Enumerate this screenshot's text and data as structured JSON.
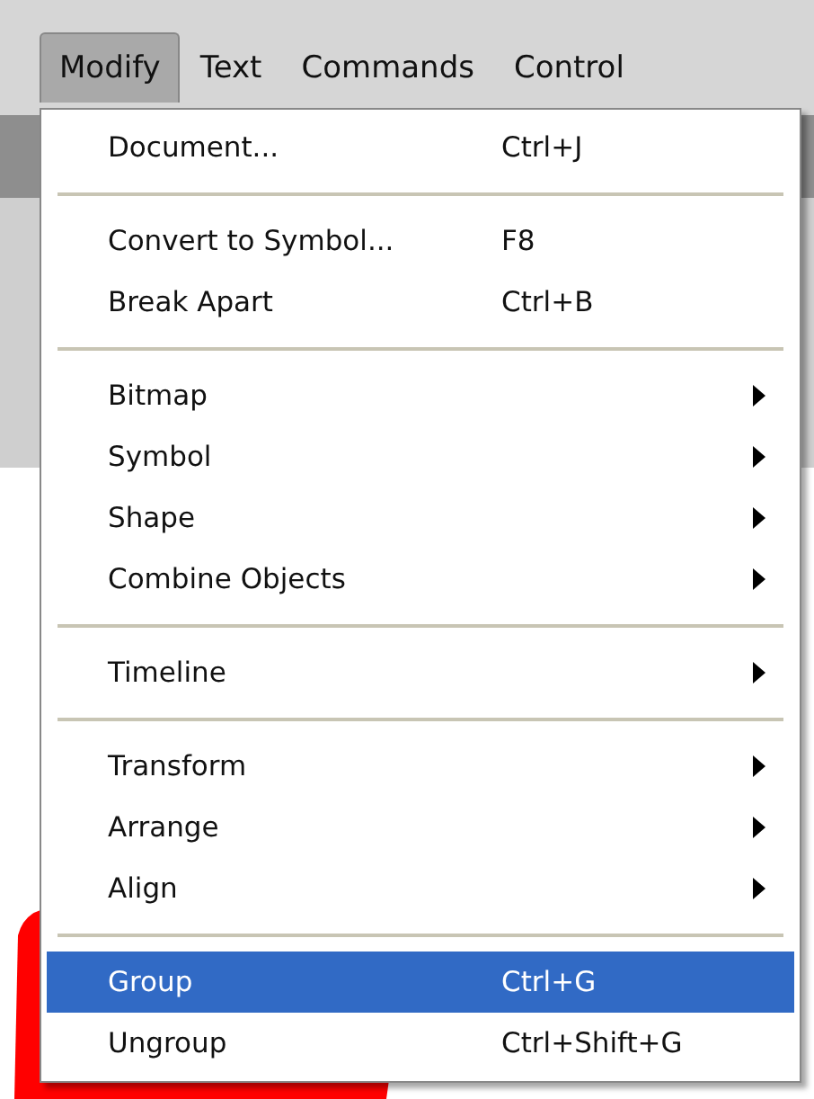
{
  "menubar": [
    {
      "label": "Modify",
      "selected": true
    },
    {
      "label": "Text",
      "selected": false
    },
    {
      "label": "Commands",
      "selected": false
    },
    {
      "label": "Control",
      "selected": false
    }
  ],
  "menu": {
    "sections": [
      [
        {
          "label": "Document...",
          "shortcut": "Ctrl+J",
          "submenu": false,
          "selected": false
        }
      ],
      [
        {
          "label": "Convert to Symbol...",
          "shortcut": "F8",
          "submenu": false,
          "selected": false
        },
        {
          "label": "Break Apart",
          "shortcut": "Ctrl+B",
          "submenu": false,
          "selected": false
        }
      ],
      [
        {
          "label": "Bitmap",
          "submenu": true,
          "selected": false
        },
        {
          "label": "Symbol",
          "submenu": true,
          "selected": false
        },
        {
          "label": "Shape",
          "submenu": true,
          "selected": false
        },
        {
          "label": "Combine Objects",
          "submenu": true,
          "selected": false
        }
      ],
      [
        {
          "label": "Timeline",
          "submenu": true,
          "selected": false
        }
      ],
      [
        {
          "label": "Transform",
          "submenu": true,
          "selected": false
        },
        {
          "label": "Arrange",
          "submenu": true,
          "selected": false
        },
        {
          "label": "Align",
          "submenu": true,
          "selected": false
        }
      ],
      [
        {
          "label": "Group",
          "shortcut": "Ctrl+G",
          "submenu": false,
          "selected": true
        },
        {
          "label": "Ungroup",
          "shortcut": "Ctrl+Shift+G",
          "submenu": false,
          "selected": false
        }
      ]
    ]
  }
}
